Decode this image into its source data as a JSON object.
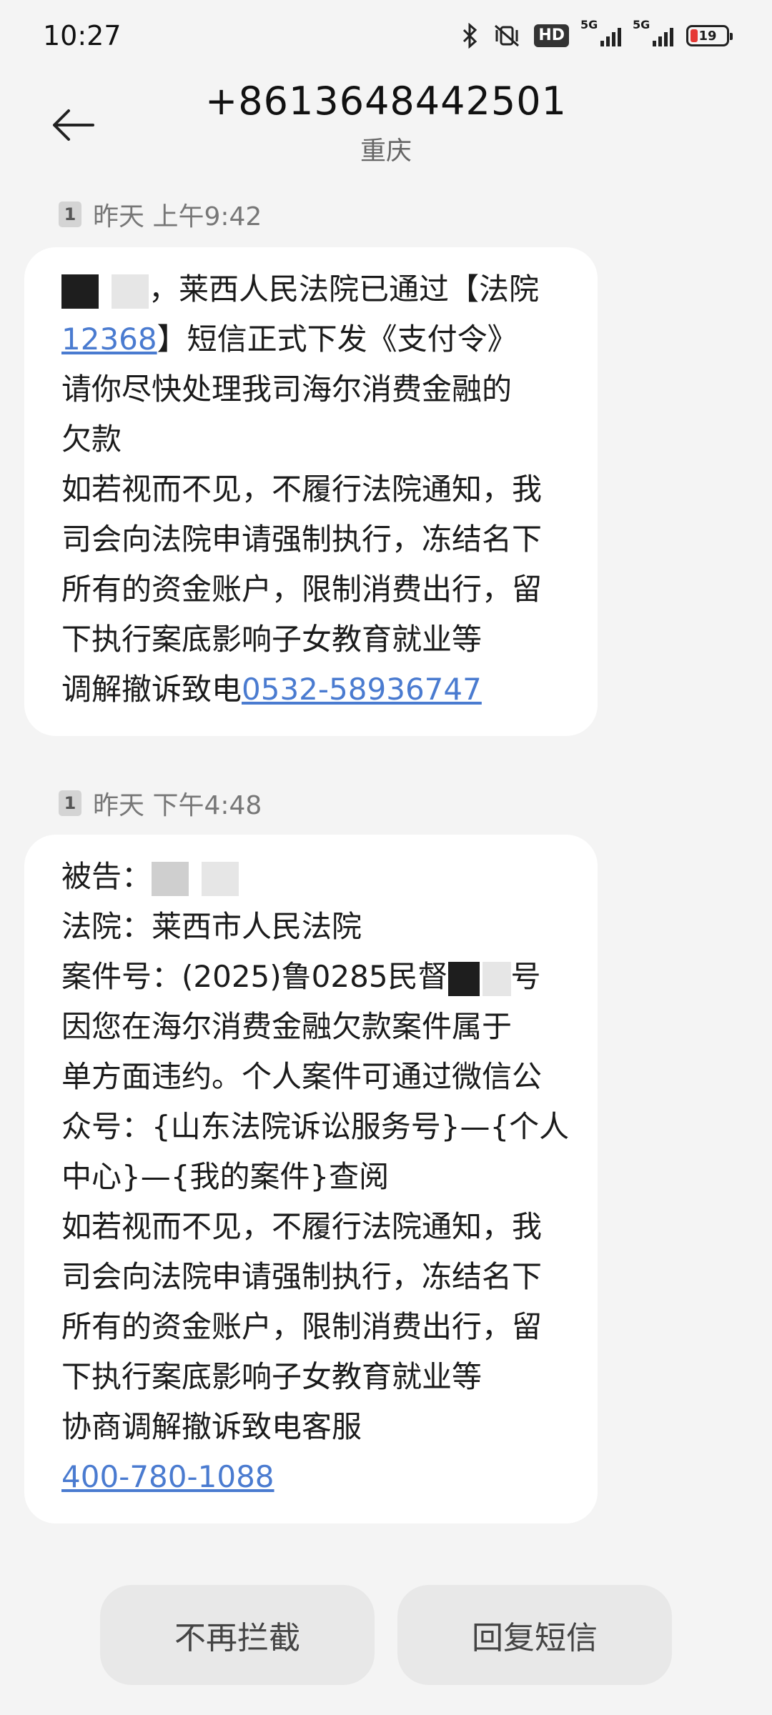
{
  "status_bar": {
    "time": "10:27",
    "hd_label": "HD",
    "signal1_label": "5G",
    "signal2_label": "5G",
    "battery_level": "19",
    "battery_color": "#e53935"
  },
  "header": {
    "back_icon": "arrow-left-icon",
    "phone_number": "+8613648442501",
    "location": "重庆"
  },
  "messages": [
    {
      "sim": "1",
      "timestamp": "昨天 上午9:42",
      "line1_after_redact": "，莱西人民法院已通过【法院",
      "line2_link": "12368",
      "line2_rest": "】短信正式下发《支付令》",
      "line3": "请你尽快处理我司海尔消费金融的",
      "line4": "欠款",
      "line5": "如若视而不见，不履行法院通知，我",
      "line6": "司会向法院申请强制执行，冻结名下",
      "line7": "所有的资金账户，限制消费出行，留",
      "line8": "下执行案底影响子女教育就业等",
      "line9_prefix": "调解撤诉致电",
      "line9_link": "0532-58936747"
    },
    {
      "sim": "1",
      "timestamp": "昨天 下午4:48",
      "line1": "被告：",
      "line2": "法院：莱西市人民法院",
      "line3_prefix": "案件号：(2025)鲁0285民督",
      "line3_suffix": "号",
      "line4": "因您在海尔消费金融欠款案件属于",
      "line5": "单方面违约。个人案件可通过微信公",
      "line6": "众号：{山东法院诉讼服务号}—{个人",
      "line7": "中心}—{我的案件}查阅",
      "line8": "如若视而不见，不履行法院通知，我",
      "line9": "司会向法院申请强制执行，冻结名下",
      "line10": "所有的资金账户，限制消费出行，留",
      "line11": "下执行案底影响子女教育就业等",
      "line12": "协商调解撤诉致电客服",
      "line13_link": "400-780-1088"
    }
  ],
  "actions": {
    "unblock_label": "不再拦截",
    "reply_label": "回复短信"
  },
  "colors": {
    "link": "#4a7bd0",
    "bubble": "#ffffff",
    "background": "#f4f4f4"
  }
}
